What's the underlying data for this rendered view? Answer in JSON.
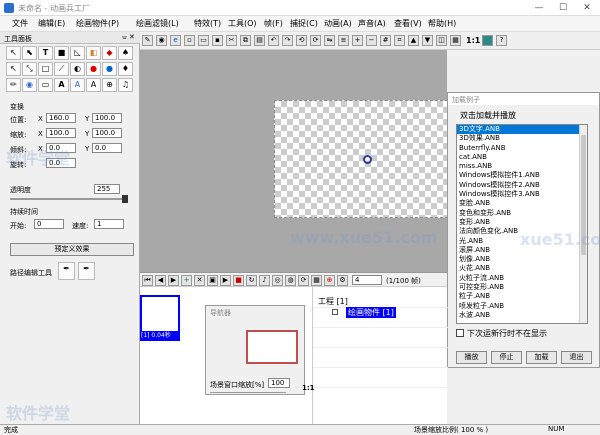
{
  "window": {
    "title": "未命名 - 动画兵工厂"
  },
  "menu": [
    "文件",
    "编辑(E)",
    "绘画物件(P)",
    "绘画滤镜(L)",
    "特效(T)",
    "工具(O)",
    "帧(F)",
    "捕捉(C)",
    "动画(A)",
    "声音(A)",
    "查看(V)",
    "帮助(H)"
  ],
  "toolbar": {
    "ratio_label": "1:1"
  },
  "tools_panel": {
    "title": "工具面板",
    "transform_label": "变换",
    "position_label": "位置:",
    "position_x": "160.0",
    "position_y": "100.0",
    "scale_label": "缩放:",
    "scale_x": "100.0",
    "scale_y": "100.0",
    "skew_label": "倾斜:",
    "skew_x": "0.0",
    "skew_y": "0.0",
    "rotate_label": "旋转:",
    "rotate_val": "0.0",
    "opacity_label": "透明度",
    "opacity_val": "255",
    "duration_label": "持续时间",
    "start_label": "开始:",
    "start_val": "0",
    "speed_label": "速度:",
    "speed_val": "1",
    "preset_button": "预定义效果",
    "path_label": "路径编辑工具"
  },
  "samples": {
    "title": "加载例子",
    "heading": "双击加载并播放",
    "items": [
      "3D文字.ANB",
      "3D效果.ANB",
      "Buterrfly.ANB",
      "cat.ANB",
      "miss.ANB",
      "Windows模拟控件1.ANB",
      "Windows模拟控件2.ANB",
      "Windows模拟控件3.ANB",
      "变脸.ANB",
      "变色和变形.ANB",
      "变形.ANB",
      "法向颜色变化.ANB",
      "光.ANB",
      "滚屏.ANB",
      "划像.ANB",
      "火花.ANB",
      "火粒子流.ANB",
      "可控变形.ANB",
      "粒子.ANB",
      "喷发粒子.ANB",
      "水波.ANB"
    ],
    "selected": 0,
    "checkbox_label": "下次运新行时不在显示",
    "play": "播放",
    "stop": "停止",
    "load": "加载",
    "exit": "退出"
  },
  "timeline": {
    "frame": "4",
    "frame_total": "(1/100 帧)",
    "thumb_label": "[1] 0.04秒",
    "project_label": "工程 [1]",
    "object_label": "绘画物件 [1]"
  },
  "navigator": {
    "title": "导航器",
    "zoom_label": "场景窗口缩放[%]",
    "zoom_val": "100",
    "ratio": "1:1"
  },
  "status": {
    "left": "完成",
    "zoom": "场景缩放比例(  100 %  )",
    "num": "NUM"
  },
  "watermarks": [
    "软件学堂",
    "www.xue51.com",
    "软件学堂",
    "xue51.com"
  ]
}
